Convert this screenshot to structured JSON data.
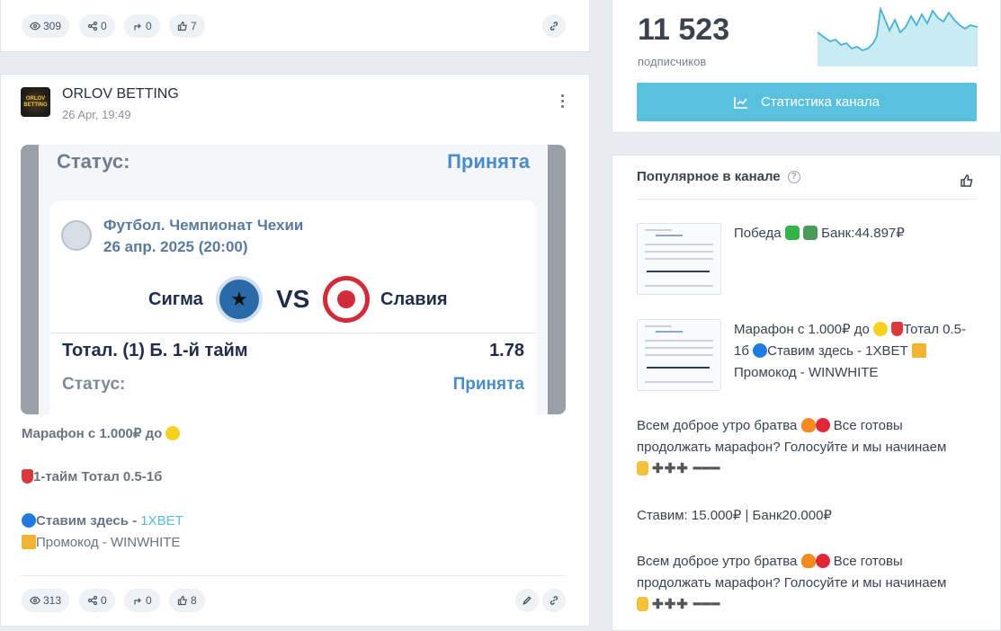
{
  "top_post": {
    "stats": {
      "views": "309",
      "shares": "0",
      "forwards": "0",
      "likes": "7"
    }
  },
  "post": {
    "channel": "ORLOV BETTING",
    "date": "26 Apr, 19:49",
    "logo_text": "ORLOV BETTING",
    "image": {
      "status_label": "Статус:",
      "status_value": "Принята",
      "competition": "Футбол. Чемпионат Чехии",
      "datetime": "26 апр. 2025 (20:00)",
      "team_home": "Сигма",
      "vs": "VS",
      "team_away": "Славия",
      "bet_label": "Тотал. (1) Б. 1-й тайм",
      "bet_odds": "1.78",
      "status_label2": "Статус:",
      "status_value2": "Принята",
      "badge_home": "SK SIGMA OLOMOUC",
      "badge_away": "SK SLAVIA PRAHA FOTBAL"
    },
    "text": {
      "line1": "Марафон с 1.000₽ до",
      "line2": "1-тайм Тотал 0.5-1б",
      "line3_prefix": "Ставим здесь - ",
      "line3_link": "1XBET",
      "line4": "Промокод - WINWHITE"
    },
    "stats": {
      "views": "313",
      "shares": "0",
      "forwards": "0",
      "likes": "8"
    }
  },
  "sidebar": {
    "subscribers": "11 523",
    "subscribers_label": "подписчиков",
    "stats_button": "Статистика канала",
    "popular_title": "Популярное в канале",
    "popular_items": [
      {
        "text_a": "Победа",
        "text_b": "Банк:44.897₽"
      },
      {
        "text_a": "Марафон с 1.000₽ до",
        "text_b": "Тотал 0.5-1б",
        "text_c": "Ставим здесь - 1XBET",
        "text_d": "Промокод - WINWHITE"
      }
    ],
    "popular_texts": [
      {
        "line1": "Всем доброе утро братва",
        "line1b": "Все готовы",
        "line2": "продолжать марафон? Голосуйте и мы начинаем"
      },
      {
        "line1": "Ставим: 15.000₽ | Банк20.000₽"
      },
      {
        "line1": "Всем доброе утро братва",
        "line1b": "Все готовы",
        "line2": "продолжать марафон? Голосуйте и мы начинаем"
      }
    ]
  },
  "colors": {
    "accent": "#5bc0de",
    "link": "#5bb8de",
    "bet_blue": "#2f6fb0",
    "status_blue": "#4a8cc7"
  }
}
